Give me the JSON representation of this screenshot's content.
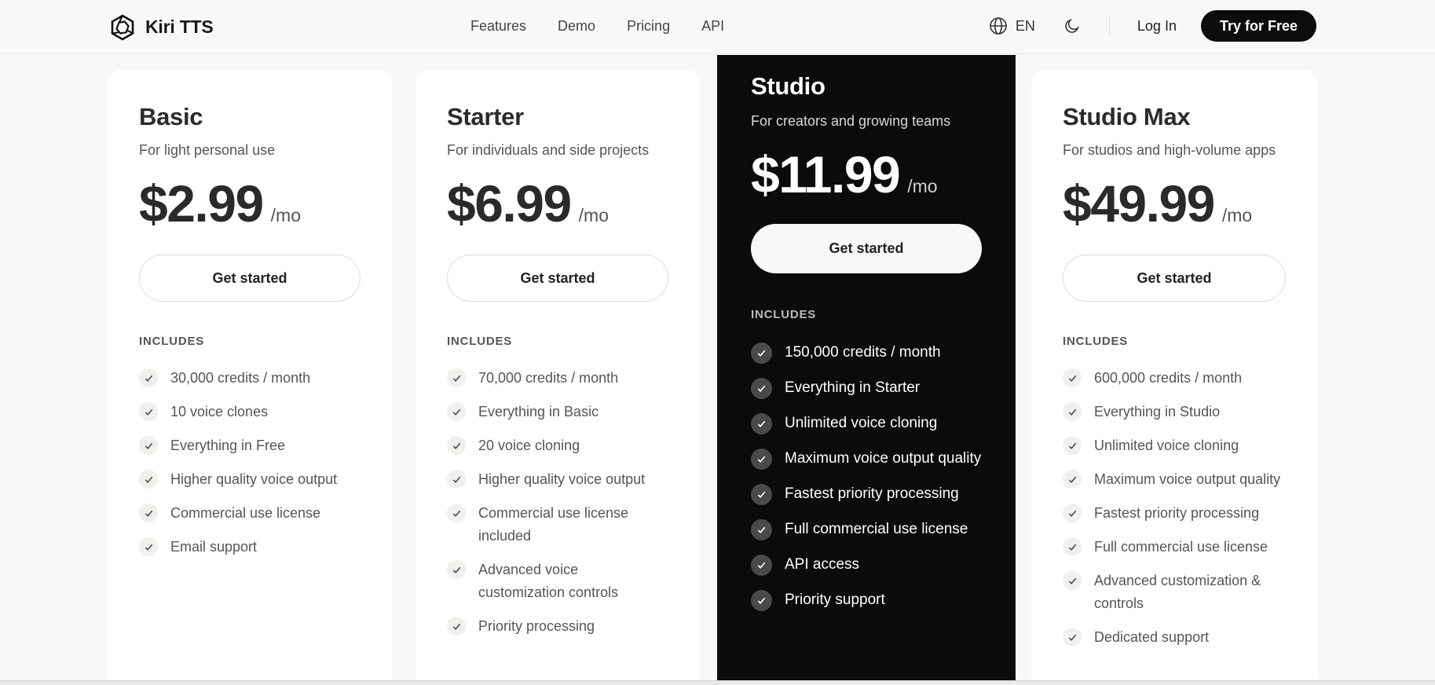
{
  "navbar": {
    "brand": "Kiri TTS",
    "links": [
      "Features",
      "Demo",
      "Pricing",
      "API"
    ],
    "language": "EN",
    "login": "Log In",
    "cta": "Try for Free"
  },
  "plans": [
    {
      "name": "Basic",
      "desc": "For light personal use",
      "price": "$2.99",
      "per": "/mo",
      "cta": "Get started",
      "includes": "INCLUDES",
      "features": [
        "30,000 credits / month",
        "10 voice clones",
        "Everything in Free",
        "Higher quality voice output",
        "Commercial use license",
        "Email support"
      ]
    },
    {
      "name": "Starter",
      "desc": "For individuals and side projects",
      "price": "$6.99",
      "per": "/mo",
      "cta": "Get started",
      "includes": "INCLUDES",
      "features": [
        "70,000 credits / month",
        "Everything in Basic",
        "20 voice cloning",
        "Higher quality voice output",
        "Commercial use license included",
        "Advanced voice customization controls",
        "Priority processing"
      ]
    },
    {
      "name": "Studio",
      "desc": "For creators and growing teams",
      "price": "$11.99",
      "per": "/mo",
      "cta": "Get started",
      "includes": "INCLUDES",
      "features": [
        "150,000 credits / month",
        "Everything in Starter",
        "Unlimited voice cloning",
        "Maximum voice output quality",
        "Fastest priority processing",
        "Full commercial use license",
        "API access",
        "Priority support"
      ]
    },
    {
      "name": "Studio Max",
      "desc": "For studios and high-volume apps",
      "price": "$49.99",
      "per": "/mo",
      "cta": "Get started",
      "includes": "INCLUDES",
      "features": [
        "600,000 credits / month",
        "Everything in Studio",
        "Unlimited voice cloning",
        "Maximum voice output quality",
        "Fastest priority processing",
        "Full commercial use license",
        "Advanced customization & controls",
        "Dedicated support"
      ]
    }
  ],
  "colors": {
    "background": "#f8f8f6",
    "card": "#ffffff",
    "featured": "#0b0b0b",
    "accent": "#0c0c0c"
  },
  "icons": {
    "brand": "hexagon-knot-logo-icon",
    "language": "globe-icon",
    "theme": "moon-icon",
    "feature": "check-icon"
  }
}
